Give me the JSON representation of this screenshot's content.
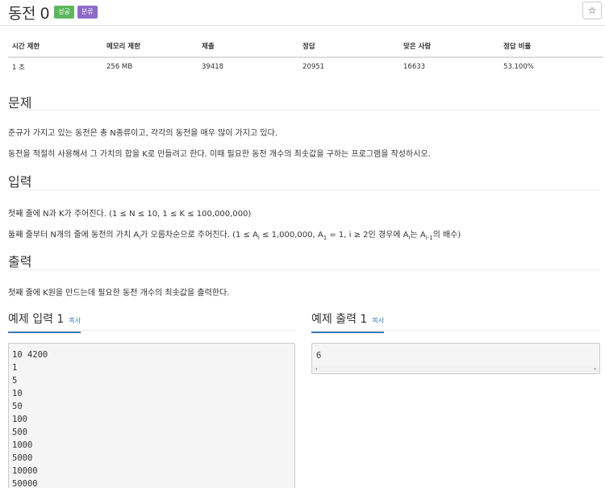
{
  "problem": {
    "title": "동전 0",
    "badges": {
      "success": "성공",
      "category": "분류"
    },
    "star": "☆"
  },
  "info_table": {
    "headers": [
      "시간 제한",
      "메모리 제한",
      "제출",
      "정답",
      "맞은 사람",
      "정답 비율"
    ],
    "values": [
      "1 초",
      "256 MB",
      "39418",
      "20951",
      "16633",
      "53.100%"
    ]
  },
  "sections": {
    "problem_title": "문제",
    "problem_p1": "준규가 가지고 있는 동전은 총 N종류이고, 각각의 동전을 매우 많이 가지고 있다.",
    "problem_p2": "동전을 적절히 사용해서 그 가치의 합을 K로 만들려고 한다. 이때 필요한 동전 개수의 최솟값을 구하는 프로그램을 작성하시오.",
    "input_title": "입력",
    "input_p1": "첫째 줄에 N과 K가 주어진다. (1 ≤ N ≤ 10, 1 ≤ K ≤ 100,000,000)",
    "input_p2": {
      "a": "둘째 줄부터 N개의 줄에 동전의 가치 A",
      "a_sub": "i",
      "b": "가 오름차순으로 주어진다. (1 ≤ A",
      "b_sub": "i",
      "c": " ≤ 1,000,000, A",
      "c_sub": "1",
      "d": " = 1, i ≥ 2인 경우에 A",
      "d_sub": "i",
      "e": "는 A",
      "e_sub": "i-1",
      "f": "의 배수)"
    },
    "output_title": "출력",
    "output_p1": "첫째 줄에 K원을 만드는데 필요한 동전 개수의 최솟값을 출력한다."
  },
  "examples": {
    "input_title": "예제 입력 1",
    "output_title": "예제 출력 1",
    "copy_label": "복사",
    "input_lines": [
      "10 4200",
      "1",
      "5",
      "10",
      "50",
      "100",
      "500",
      "1000",
      "5000",
      "10000",
      "50000"
    ],
    "output_lines": [
      "6"
    ]
  },
  "icons": {
    "scroll_left": "◂",
    "scroll_right": "▸"
  },
  "colors": {
    "success": "#5cb85c",
    "category": "#8e6bc9",
    "link": "#337ab7"
  }
}
